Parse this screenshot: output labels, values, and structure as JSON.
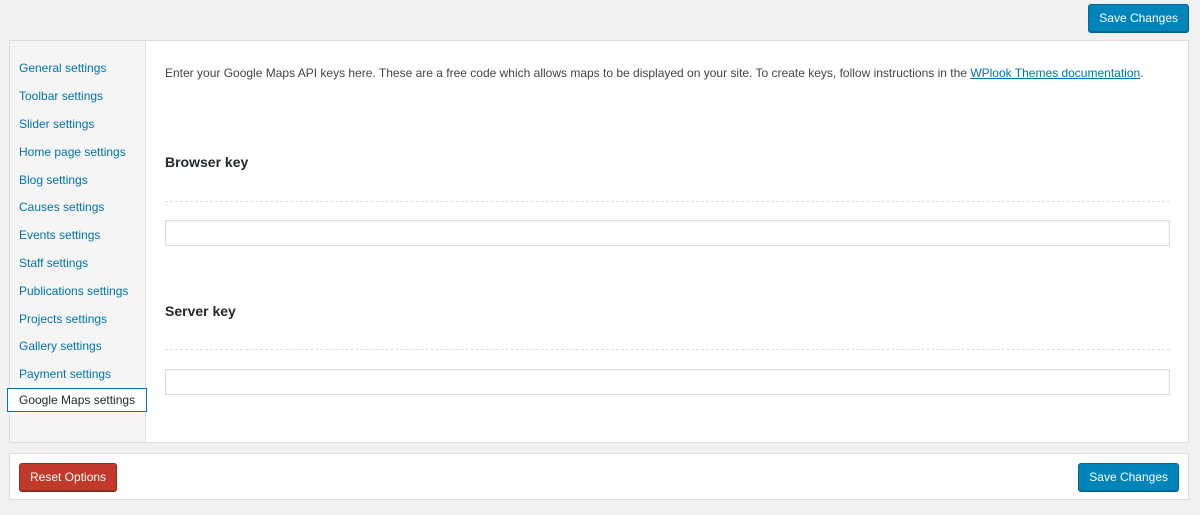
{
  "header": {
    "save_label": "Save Changes"
  },
  "sidebar": {
    "items": [
      {
        "label": "General settings"
      },
      {
        "label": "Toolbar settings"
      },
      {
        "label": "Slider settings"
      },
      {
        "label": "Home page settings"
      },
      {
        "label": "Blog settings"
      },
      {
        "label": "Causes settings"
      },
      {
        "label": "Events settings"
      },
      {
        "label": "Staff settings"
      },
      {
        "label": "Publications settings"
      },
      {
        "label": "Projects settings"
      },
      {
        "label": "Gallery settings"
      },
      {
        "label": "Payment settings"
      },
      {
        "label": "Google Maps settings",
        "active": true
      }
    ]
  },
  "main": {
    "intro_text": "Enter your Google Maps API keys here. These are a free code which allows maps to be displayed on your site. To create keys, follow instructions in the ",
    "intro_link": "WPlook Themes documentation",
    "intro_end": ".",
    "browser_key": {
      "heading": "Browser key",
      "value": "",
      "placeholder": ""
    },
    "server_key": {
      "heading": "Server key",
      "value": "",
      "placeholder": ""
    }
  },
  "footer": {
    "reset_label": "Reset Options",
    "save_label": "Save Changes"
  },
  "colors": {
    "primary": "#0085ba",
    "danger": "#c0392b",
    "link": "#0073aa"
  }
}
